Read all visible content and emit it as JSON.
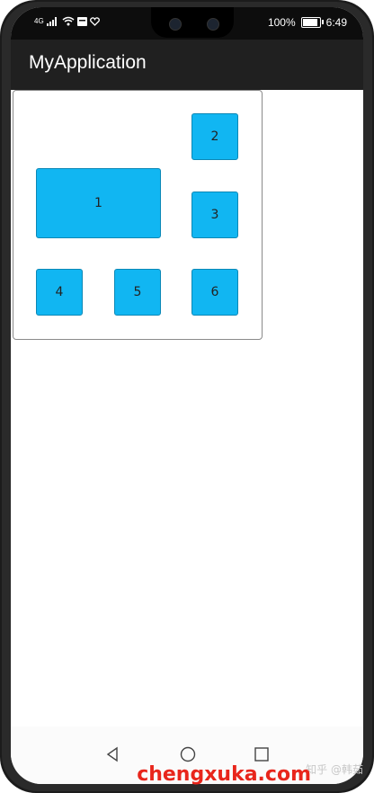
{
  "status_bar": {
    "time": "6:49",
    "battery_percent": "100%",
    "battery_level": 1.0,
    "signal_label": "4G"
  },
  "app_bar": {
    "title": "MyApplication"
  },
  "grid": {
    "tiles": [
      {
        "label": "1"
      },
      {
        "label": "2"
      },
      {
        "label": "3"
      },
      {
        "label": "4"
      },
      {
        "label": "5"
      },
      {
        "label": "6"
      }
    ],
    "tile_color": "#11b6f2"
  },
  "nav_bar": {
    "back_icon": "back-triangle-icon",
    "home_icon": "home-circle-icon",
    "recents_icon": "recents-square-icon"
  },
  "watermark": {
    "text": "chengxuka.com",
    "secondary": "知乎 @韩茹"
  }
}
